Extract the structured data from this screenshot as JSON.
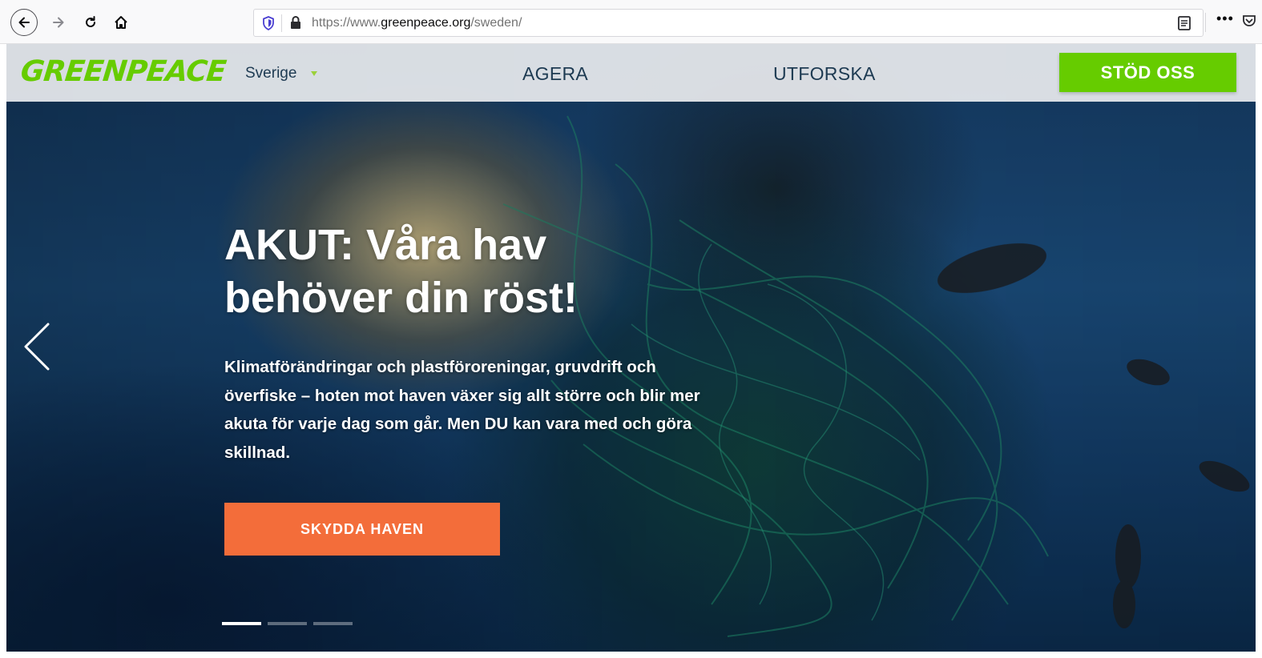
{
  "browser": {
    "url_prefix": "https://www.",
    "url_domain": "greenpeace.org",
    "url_path": "/sweden/"
  },
  "header": {
    "logo_text": "GREENPEACE",
    "country": "Sverige",
    "nav": [
      "AGERA",
      "UTFORSKA"
    ],
    "donate_label": "STÖD OSS",
    "brand_color": "#66cc00"
  },
  "hero": {
    "title_line1": "AKUT: Våra hav",
    "title_line2": "behöver din röst!",
    "lead": "Klimatförändringar och plastföroreningar, gruvdrift och överfiske – hoten mot haven växer sig allt större och blir mer akuta för varje dag som går. Men DU kan vara med och göra skillnad.",
    "cta_label": "SKYDDA HAVEN",
    "cta_color": "#f36d3a",
    "slides_total": 3,
    "slide_active": 1
  }
}
